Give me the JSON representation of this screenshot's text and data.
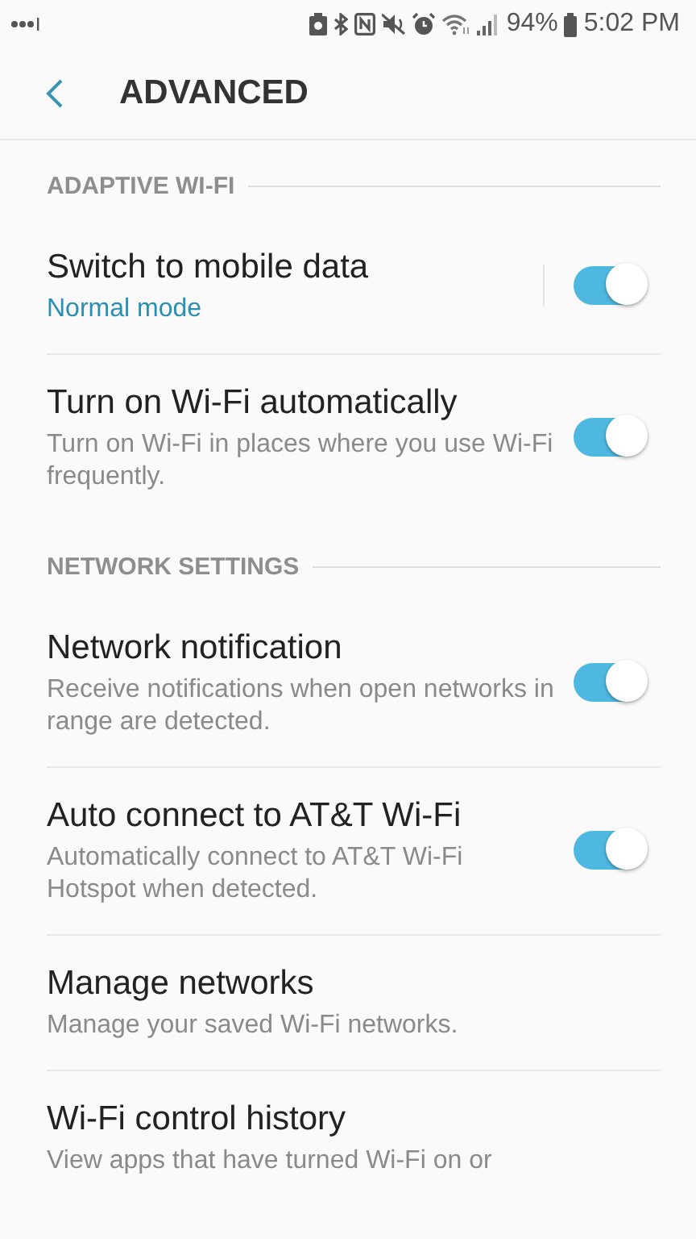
{
  "status_bar": {
    "battery": "94%",
    "time": "5:02 PM"
  },
  "header": {
    "title": "ADVANCED"
  },
  "sections": [
    {
      "title": "ADAPTIVE WI-FI",
      "items": [
        {
          "kind": "split-switch",
          "title": "Switch to mobile data",
          "subtitle": "Normal mode",
          "subtitle_accent": true,
          "on": true
        },
        {
          "kind": "switch",
          "title": "Turn on Wi-Fi automatically",
          "subtitle": "Turn on Wi-Fi in places where you use Wi-Fi frequently.",
          "subtitle_accent": false,
          "on": true
        }
      ]
    },
    {
      "title": "NETWORK SETTINGS",
      "items": [
        {
          "kind": "switch",
          "title": "Network notification",
          "subtitle": "Receive notifications when open networks in range are detected.",
          "subtitle_accent": false,
          "on": true
        },
        {
          "kind": "switch",
          "title": "Auto connect to AT&T Wi-Fi",
          "subtitle": "Automatically connect to AT&T Wi-Fi Hotspot when detected.",
          "subtitle_accent": false,
          "on": true
        },
        {
          "kind": "plain",
          "title": "Manage networks",
          "subtitle": "Manage your saved Wi-Fi networks.",
          "subtitle_accent": false
        },
        {
          "kind": "plain",
          "title": "Wi-Fi control history",
          "subtitle": "View apps that have turned Wi-Fi on or",
          "subtitle_accent": false
        }
      ]
    }
  ]
}
